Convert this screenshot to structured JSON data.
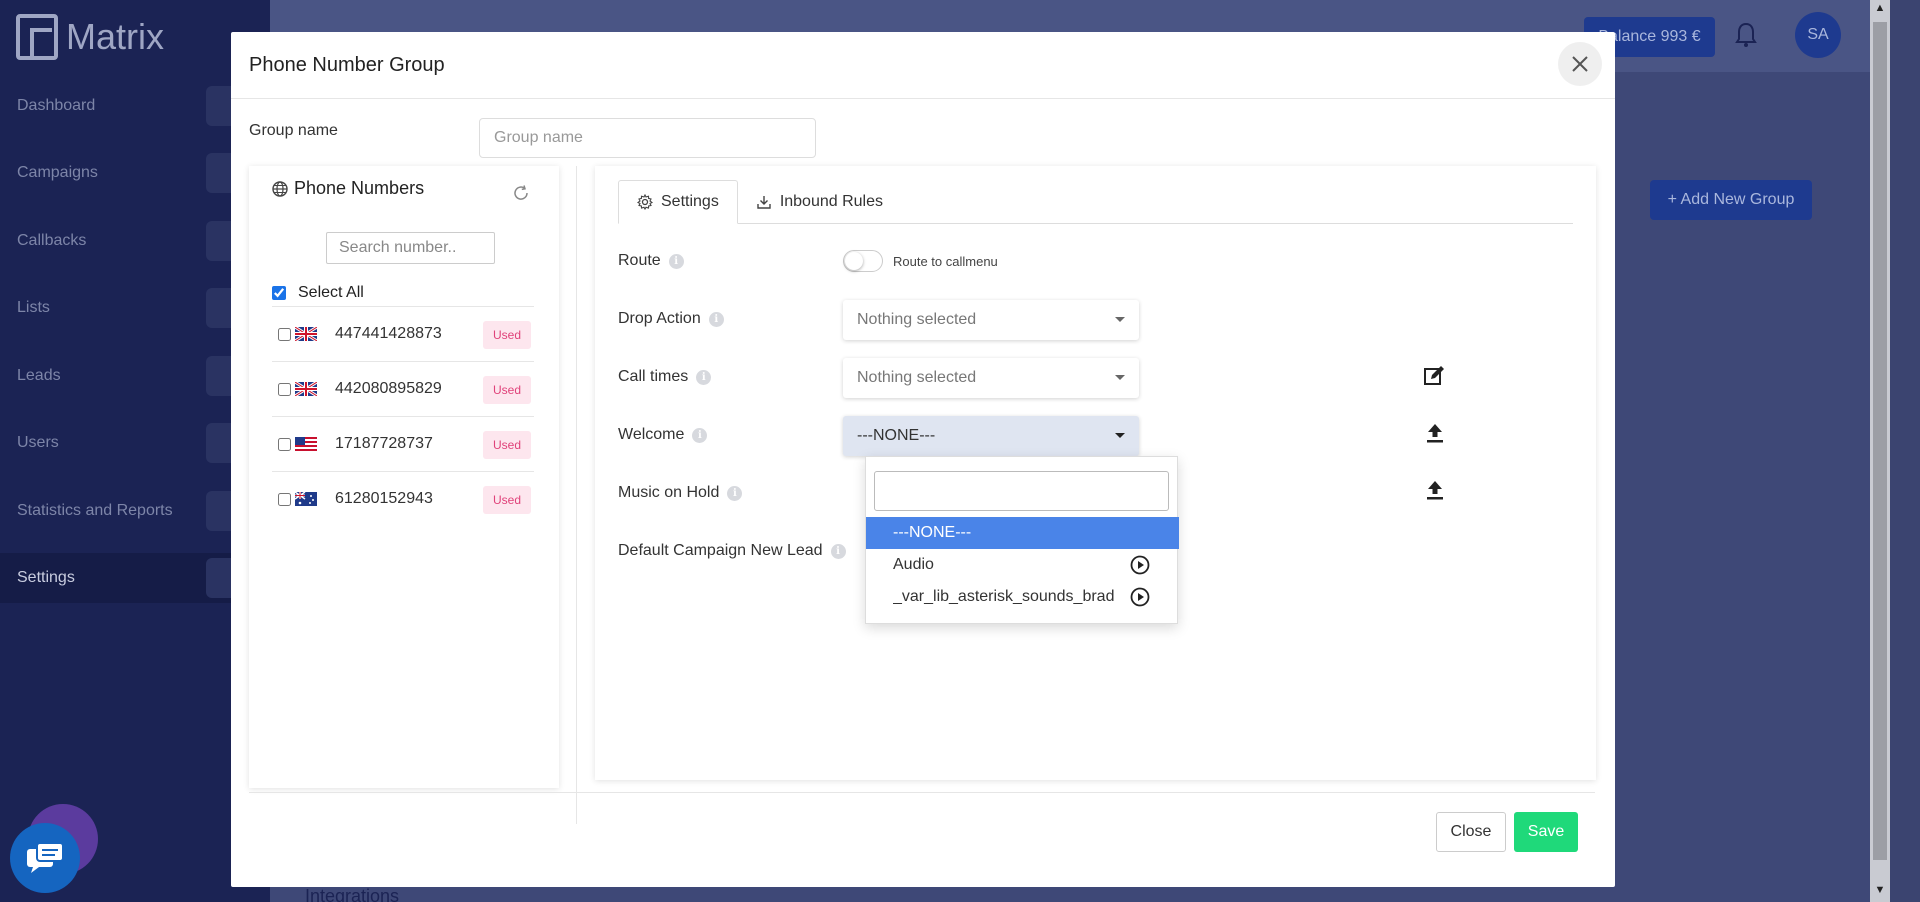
{
  "app": {
    "logo_text": "Matrix",
    "balance": "Balance 993 €",
    "avatar_initials": "SA",
    "add_group_label": "+ Add New Group",
    "integrations_label": "Integrations",
    "sidebar": [
      {
        "label": "Dashboard"
      },
      {
        "label": "Campaigns"
      },
      {
        "label": "Callbacks"
      },
      {
        "label": "Lists"
      },
      {
        "label": "Leads"
      },
      {
        "label": "Users"
      },
      {
        "label": "Statistics and Reports"
      },
      {
        "label": "Settings"
      }
    ]
  },
  "modal": {
    "title": "Phone Number Group",
    "group_name_label": "Group name",
    "group_name_placeholder": "Group name",
    "close_label": "Close",
    "save_label": "Save"
  },
  "phone_numbers": {
    "title": "Phone Numbers",
    "search_placeholder": "Search number..",
    "select_all_label": "Select All",
    "select_all_checked": true,
    "items": [
      {
        "number": "447441428873",
        "flag": "uk-flag-icon",
        "badge": "Used"
      },
      {
        "number": "442080895829",
        "flag": "uk-flag-icon",
        "badge": "Used"
      },
      {
        "number": "17187728737",
        "flag": "us-flag-icon",
        "badge": "Used"
      },
      {
        "number": "61280152943",
        "flag": "au-flag-icon",
        "badge": "Used"
      }
    ]
  },
  "settings": {
    "tabs": [
      {
        "label": "Settings",
        "active": true,
        "icon": "gear-icon"
      },
      {
        "label": "Inbound Rules",
        "active": false,
        "icon": "download-icon"
      }
    ],
    "route_label": "Route",
    "route_toggle_label": "Route to callmenu",
    "drop_action_label": "Drop Action",
    "drop_action_value": "Nothing selected",
    "call_times_label": "Call times",
    "call_times_value": "Nothing selected",
    "welcome_label": "Welcome",
    "welcome_value": "---NONE---",
    "music_on_hold_label": "Music on Hold",
    "default_campaign_label": "Default Campaign New Lead"
  },
  "dropdown": {
    "search_value": "",
    "options": [
      {
        "label": "---NONE---",
        "selected": true
      },
      {
        "label": "Audio",
        "selected": false
      },
      {
        "label": "_var_lib_asterisk_sounds_brado",
        "selected": false
      }
    ]
  },
  "colors": {
    "accent_blue": "#4a84e8",
    "save_green": "#1fd97a",
    "used_badge": "#e0427a"
  }
}
